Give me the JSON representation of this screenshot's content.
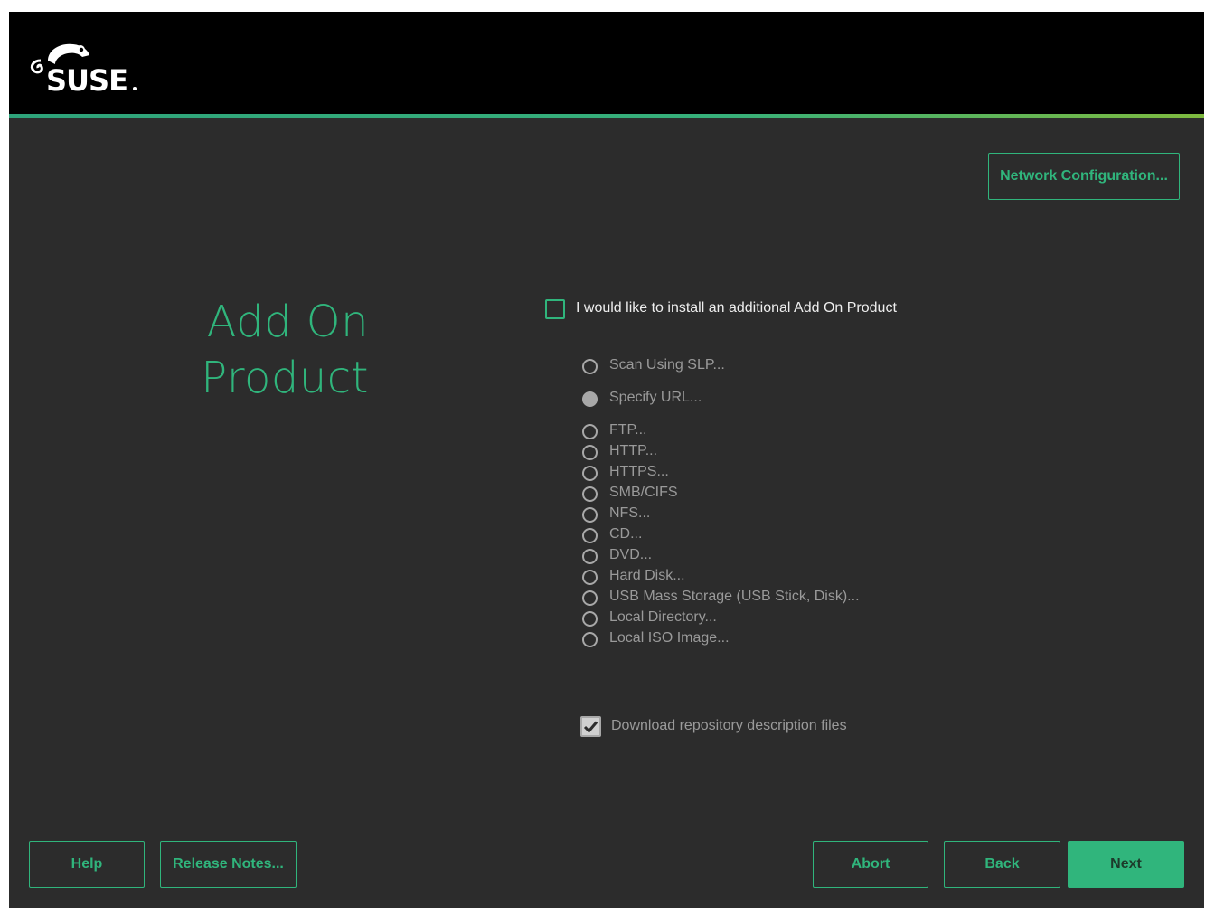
{
  "header": {
    "logo_text": "SUSE"
  },
  "toolbar": {
    "network_configuration": "Network Configuration..."
  },
  "page": {
    "title_line1": "Add On",
    "title_line2": "Product"
  },
  "addon": {
    "install_checkbox_label": "I would like to install an additional Add On Product",
    "install_checked": false,
    "options": [
      {
        "label": "Scan Using SLP...",
        "selected": false
      },
      {
        "label": "Specify URL...",
        "selected": true
      },
      {
        "label": "FTP...",
        "selected": false
      },
      {
        "label": "HTTP...",
        "selected": false
      },
      {
        "label": "HTTPS...",
        "selected": false
      },
      {
        "label": "SMB/CIFS",
        "selected": false
      },
      {
        "label": "NFS...",
        "selected": false
      },
      {
        "label": "CD...",
        "selected": false
      },
      {
        "label": "DVD...",
        "selected": false
      },
      {
        "label": "Hard Disk...",
        "selected": false
      },
      {
        "label": "USB Mass Storage (USB Stick, Disk)...",
        "selected": false
      },
      {
        "label": "Local Directory...",
        "selected": false
      },
      {
        "label": "Local ISO Image...",
        "selected": false
      }
    ],
    "download_label": "Download repository description files",
    "download_checked": true
  },
  "footer": {
    "help": "Help",
    "release_notes": "Release Notes...",
    "abort": "Abort",
    "back": "Back",
    "next": "Next"
  },
  "colors": {
    "accent": "#30b57c",
    "background": "#2c2c2c",
    "header": "#000000",
    "disabled_text": "#9a9a9a"
  }
}
